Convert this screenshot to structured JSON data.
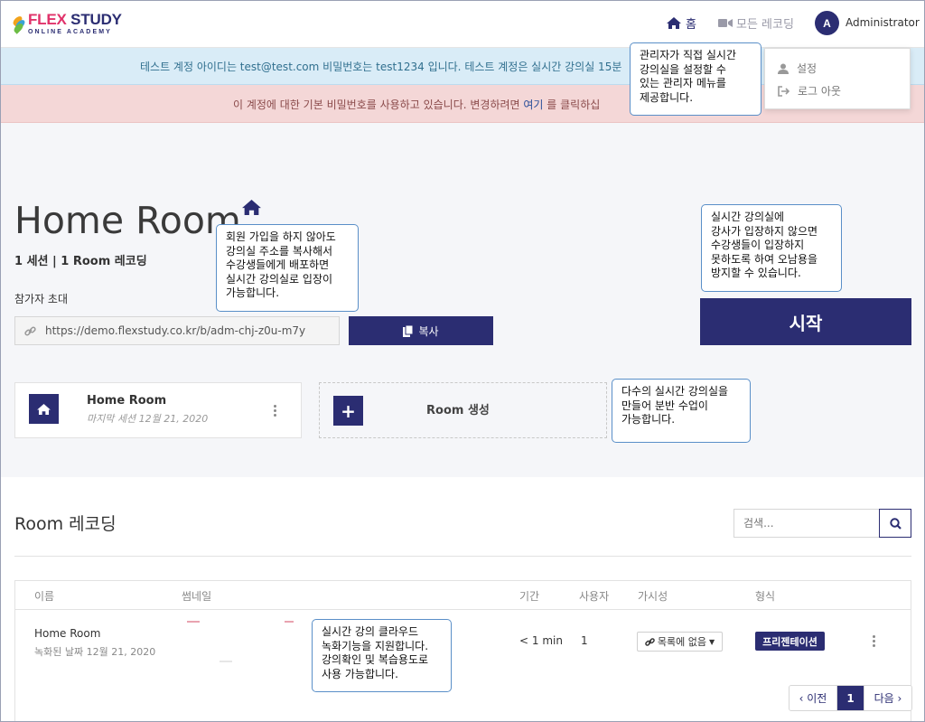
{
  "header": {
    "logo_main_a": "FLEX",
    "logo_main_b": " STUDY",
    "logo_sub": "ONLINE ACADEMY",
    "nav_home": "홈",
    "nav_all_recordings": "모든 레코딩",
    "avatar_initial": "A",
    "user_name": "Administrator"
  },
  "dropdown": {
    "items": [
      {
        "label": "설정",
        "icon": "user-icon"
      },
      {
        "label": "로그 아웃",
        "icon": "sign-out-icon"
      }
    ]
  },
  "banners": {
    "info": "테스트 계정 아이디는 test@test.com 비밀번호는 test1234 입니다. 테스트 계정은 실시간 강의실 15분",
    "warn_text": "이 계정에 대한 기본 비밀번호를 사용하고 있습니다. 변경하려면 ",
    "warn_link": "여기",
    "warn_tail": " 를 클릭하십"
  },
  "room": {
    "title": "Home Room",
    "session_info": "1 세션 | 1 Room 레코딩",
    "invite_label": "참가자 초대",
    "invite_url": "https://demo.flexstudy.co.kr/b/adm-chj-z0u-m7y",
    "copy_label": "복사",
    "start_label": "시작"
  },
  "room_cards": {
    "home": {
      "name": "Home Room",
      "last_session": "마지막 세션 12월 21, 2020"
    },
    "create_label": "Room 생성"
  },
  "recordings": {
    "title": "Room 레코딩",
    "search_placeholder": "검색...",
    "columns": [
      "이름",
      "썸네일",
      "기간",
      "사용자",
      "가시성",
      "형식"
    ],
    "rows": [
      {
        "name": "Home Room",
        "recorded": "녹화된 날짜 12월 21, 2020",
        "duration": "< 1 min",
        "users": "1",
        "visibility": "목록에 없음",
        "format": "프리젠테이션"
      }
    ]
  },
  "pagination": {
    "prev": "‹ 이전",
    "current": "1",
    "next": "다음 ›"
  },
  "tooltips": {
    "admin_menu": "관리자가 직접 실시간\n강의실을 설정할 수\n있는 관리자 메뉴를\n제공합니다.",
    "copy_url": "회원 가입을 하지 않아도\n강의실 주소를 복사해서\n수강생들에게 배포하면\n실시간 강의실로 입장이\n가능합니다.",
    "start": "실시간 강의실에\n강사가 입장하지 않으면\n수강생들이 입장하지\n못하도록 하여 오남용을\n방지할 수 있습니다.",
    "create_room": "다수의 실시간 강의실을\n만들어  분반 수업이\n가능합니다.",
    "recording": "실시간 강의 클라우드\n녹화기능을 지원합니다.\n강의확인 및 복습용도로\n사용 가능합니다."
  },
  "colors": {
    "brand": "#2b2d72",
    "logo_accent": "#e0326a",
    "info_bg": "#d9ecf7",
    "warn_bg": "#f4d7d7",
    "main_bg": "#f5f6f9"
  }
}
